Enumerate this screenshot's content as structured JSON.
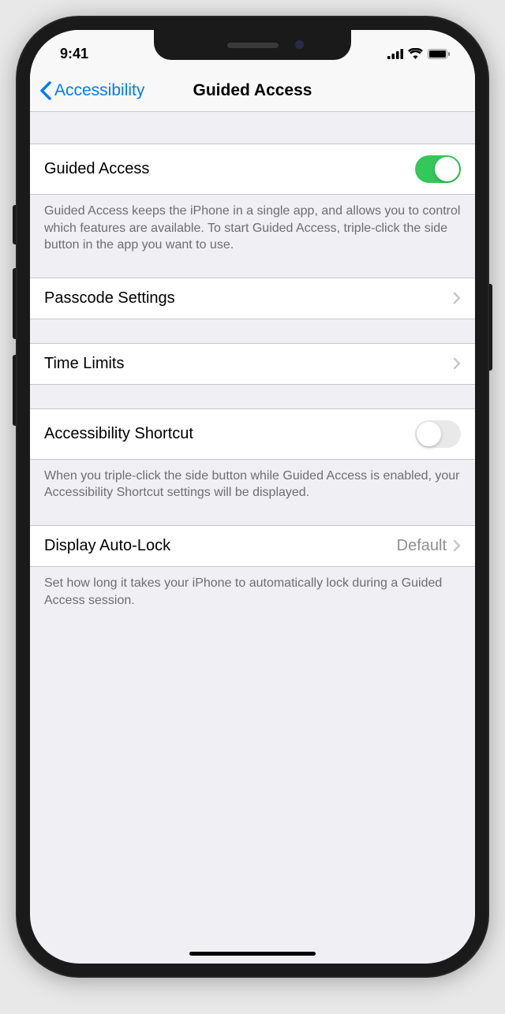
{
  "status": {
    "time": "9:41"
  },
  "nav": {
    "back_label": "Accessibility",
    "title": "Guided Access"
  },
  "sections": {
    "guided_access": {
      "label": "Guided Access",
      "enabled": true,
      "footer": "Guided Access keeps the iPhone in a single app, and allows you to control which features are available. To start Guided Access, triple-click the side button in the app you want to use."
    },
    "passcode": {
      "label": "Passcode Settings"
    },
    "time_limits": {
      "label": "Time Limits"
    },
    "shortcut": {
      "label": "Accessibility Shortcut",
      "enabled": false,
      "footer": "When you triple-click the side button while Guided Access is enabled, your Accessibility Shortcut settings will be displayed."
    },
    "autolock": {
      "label": "Display Auto-Lock",
      "value": "Default",
      "footer": "Set how long it takes your iPhone to automatically lock during a Guided Access session."
    }
  }
}
